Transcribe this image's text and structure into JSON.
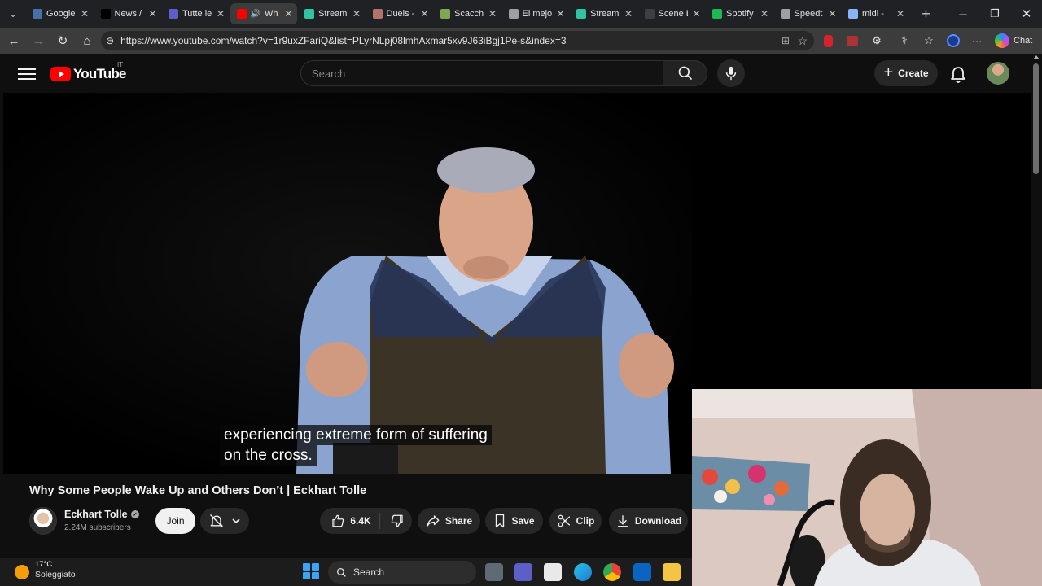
{
  "browser": {
    "tabs": [
      {
        "title": "Google",
        "icon": "google-docs-icon",
        "color": "#4a6fa5"
      },
      {
        "title": "News / ",
        "icon": "x-icon",
        "color": "#000000"
      },
      {
        "title": "Tutte le",
        "icon": "teams-icon",
        "color": "#5b5fc7"
      },
      {
        "title": "Wh",
        "icon": "youtube-icon",
        "color": "#ff0000",
        "active": true
      },
      {
        "title": "Stream",
        "icon": "streamlabs-icon",
        "color": "#31c3a2"
      },
      {
        "title": "Duels -",
        "icon": "duels-icon",
        "color": "#b3736b"
      },
      {
        "title": "Scacchi",
        "icon": "chess-icon",
        "color": "#7fa650"
      },
      {
        "title": "El mejo",
        "icon": "site-icon",
        "color": "#9aa0a6"
      },
      {
        "title": "Streaml",
        "icon": "streamlabs-icon",
        "color": "#31c3a2"
      },
      {
        "title": "Scene E",
        "icon": "obs-icon",
        "color": "#3c4043"
      },
      {
        "title": "Spotify",
        "icon": "spotify-icon",
        "color": "#1db954"
      },
      {
        "title": "Speedt",
        "icon": "speedtest-icon",
        "color": "#9aa0a6"
      },
      {
        "title": "midi - ",
        "icon": "search-icon",
        "color": "#8ab4f8"
      }
    ],
    "url": "https://www.youtube.com/watch?v=1r9uxZFariQ&list=PLyrNLpj08lmhAxmar5xv9J63iBgj1Pe-s&index=3",
    "chat_label": "Chat"
  },
  "youtube": {
    "logo_text": "YouTube",
    "country_code": "IT",
    "search_placeholder": "Search",
    "create_label": "Create"
  },
  "video": {
    "caption_line1": "experiencing extreme form of suffering",
    "caption_line2": "on the cross.",
    "title": "Why Some People Wake Up and Others Don’t | Eckhart Tolle",
    "channel_name": "Eckhart Tolle",
    "subscribers": "2.24M subscribers",
    "join_label": "Join",
    "likes": "6.4K",
    "share_label": "Share",
    "save_label": "Save",
    "clip_label": "Clip",
    "download_label": "Download"
  },
  "taskbar": {
    "temperature": "17°C",
    "weather": "Soleggiato",
    "search_label": "Search"
  }
}
